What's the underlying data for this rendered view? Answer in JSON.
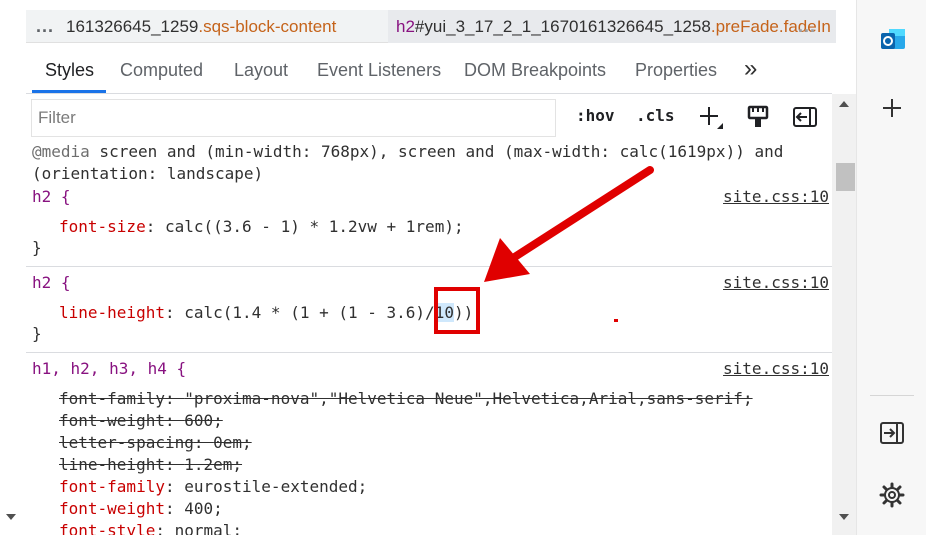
{
  "breadcrumbs": {
    "more_left": "...",
    "first": {
      "text_plain": "161326645_1259",
      "text_cls": ".sqs-block-content"
    },
    "second": {
      "tag": "h2",
      "id": "#yui_3_17_2_1_1670161326645_1258",
      "cls": ".preFade.fadeIn"
    },
    "more_right": "..."
  },
  "tabs": [
    "Styles",
    "Computed",
    "Layout",
    "Event Listeners",
    "DOM Breakpoints",
    "Properties"
  ],
  "tabs_overflow": "»",
  "filter": {
    "placeholder": "Filter",
    "value": ""
  },
  "toolbar": {
    "hov": ":hov",
    "cls": ".cls"
  },
  "rules": {
    "media": {
      "keyword": "@media",
      "text1": " screen and (min-width: 768px), screen and (max-width: calc(1619px)) and",
      "text2": "(orientation: landscape)"
    },
    "r1": {
      "selector": "h2 {",
      "source": "site.css:10",
      "prop": "font-size",
      "value": "calc((3.6 - 1) * 1.2vw + 1rem);",
      "close": "}"
    },
    "r2": {
      "selector": "h2 {",
      "source": "site.css:10",
      "prop": "line-height",
      "value_a": "calc(1.4 * (1 + (1 - 3.6)/",
      "value_hl": "10",
      "value_b": "));",
      "close": "}"
    },
    "r3": {
      "selector": "h1, h2, h3, h4 {",
      "source": "site.css:10",
      "decls": [
        {
          "prop": "font-family",
          "value": "\"proxima-nova\",\"Helvetica Neue\",Helvetica,Arial,sans-serif;",
          "struck": true
        },
        {
          "prop": "font-weight",
          "value": "600;",
          "struck": true
        },
        {
          "prop": "letter-spacing",
          "value": "0em;",
          "struck": true
        },
        {
          "prop": "line-height",
          "value": "1.2em;",
          "struck": true
        },
        {
          "prop": "font-family",
          "value": "eurostile-extended;",
          "struck": false
        },
        {
          "prop": "font-weight",
          "value": "400;",
          "struck": false
        },
        {
          "prop": "font-style",
          "value": "normal;",
          "struck": false
        }
      ]
    }
  },
  "colors": {
    "accent": "#1a73e8",
    "annotation": "#e00000",
    "selector": "#881280",
    "property": "#c80000"
  },
  "sidebar_icons": [
    "outlook-icon",
    "add-icon",
    "exit-sidebar-icon",
    "settings-gear-icon"
  ]
}
